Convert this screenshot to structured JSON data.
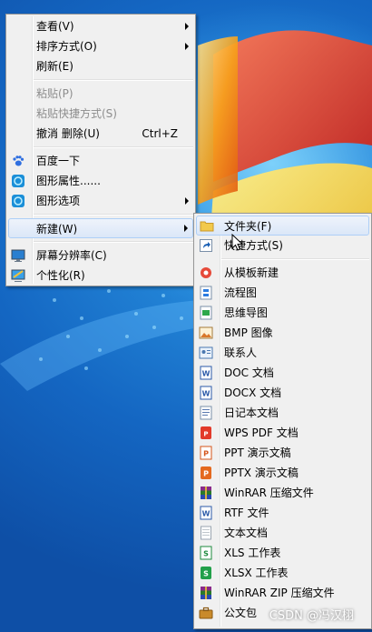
{
  "context_menu": {
    "items": [
      {
        "label": "查看(V)",
        "shortcut": "",
        "submenu": true,
        "disabled": false,
        "icon": ""
      },
      {
        "label": "排序方式(O)",
        "shortcut": "",
        "submenu": true,
        "disabled": false,
        "icon": ""
      },
      {
        "label": "刷新(E)",
        "shortcut": "",
        "submenu": false,
        "disabled": false,
        "icon": ""
      },
      {
        "label": "粘贴(P)",
        "shortcut": "",
        "submenu": false,
        "disabled": true,
        "icon": ""
      },
      {
        "label": "粘贴快捷方式(S)",
        "shortcut": "",
        "submenu": false,
        "disabled": true,
        "icon": ""
      },
      {
        "label": "撤消 删除(U)",
        "shortcut": "Ctrl+Z",
        "submenu": false,
        "disabled": false,
        "icon": ""
      },
      {
        "label": "百度一下",
        "shortcut": "",
        "submenu": false,
        "disabled": false,
        "icon": "baidu-paw-icon"
      },
      {
        "label": "图形属性......",
        "shortcut": "",
        "submenu": false,
        "disabled": false,
        "icon": "intel-graphics-icon"
      },
      {
        "label": "图形选项",
        "shortcut": "",
        "submenu": true,
        "disabled": false,
        "icon": "intel-graphics-icon"
      },
      {
        "label": "新建(W)",
        "shortcut": "",
        "submenu": true,
        "disabled": false,
        "icon": ""
      },
      {
        "label": "屏幕分辨率(C)",
        "shortcut": "",
        "submenu": false,
        "disabled": false,
        "icon": "screen-resolution-icon"
      },
      {
        "label": "个性化(R)",
        "shortcut": "",
        "submenu": false,
        "disabled": false,
        "icon": "personalize-icon"
      }
    ]
  },
  "new_submenu": {
    "items": [
      {
        "label": "文件夹(F)",
        "icon": "folder-icon"
      },
      {
        "label": "快捷方式(S)",
        "icon": "shortcut-icon"
      },
      {
        "label": "从模板新建",
        "icon": "template-icon"
      },
      {
        "label": "流程图",
        "icon": "flowchart-icon"
      },
      {
        "label": "思维导图",
        "icon": "mindmap-icon"
      },
      {
        "label": "BMP 图像",
        "icon": "bmp-image-icon"
      },
      {
        "label": "联系人",
        "icon": "contact-icon"
      },
      {
        "label": "DOC 文档",
        "icon": "doc-icon"
      },
      {
        "label": "DOCX 文档",
        "icon": "docx-icon"
      },
      {
        "label": "日记本文档",
        "icon": "journal-icon"
      },
      {
        "label": "WPS PDF 文档",
        "icon": "pdf-icon"
      },
      {
        "label": "PPT 演示文稿",
        "icon": "ppt-icon"
      },
      {
        "label": "PPTX 演示文稿",
        "icon": "pptx-icon"
      },
      {
        "label": "WinRAR 压缩文件",
        "icon": "winrar-icon"
      },
      {
        "label": "RTF 文件",
        "icon": "rtf-icon"
      },
      {
        "label": "文本文档",
        "icon": "text-doc-icon"
      },
      {
        "label": "XLS 工作表",
        "icon": "xls-icon"
      },
      {
        "label": "XLSX 工作表",
        "icon": "xlsx-icon"
      },
      {
        "label": "WinRAR ZIP 压缩文件",
        "icon": "winrar-zip-icon"
      },
      {
        "label": "公文包",
        "icon": "briefcase-icon"
      }
    ]
  },
  "watermark": "CSDN @冯汉栩"
}
